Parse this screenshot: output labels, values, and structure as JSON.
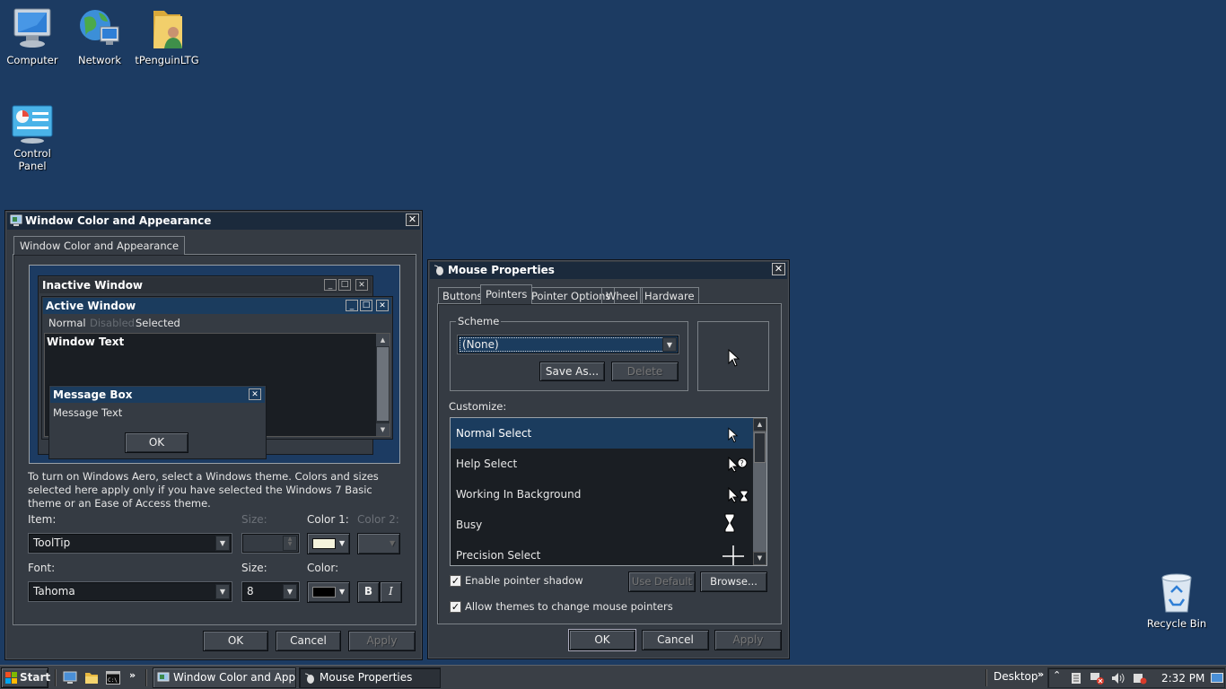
{
  "desktop": {
    "icons": [
      {
        "label": "Computer",
        "icon": "computer-icon"
      },
      {
        "label": "Network",
        "icon": "network-icon"
      },
      {
        "label": "tPenguinLTG",
        "icon": "user-folder-icon"
      },
      {
        "label": "Control Panel",
        "icon": "control-panel-icon"
      },
      {
        "label": "Recycle Bin",
        "icon": "recycle-bin-icon"
      }
    ]
  },
  "appearance": {
    "title": "Window Color and Appearance",
    "tab": "Window Color and Appearance",
    "preview": {
      "inactive": "Inactive Window",
      "active": "Active Window",
      "menu_normal": "Normal",
      "menu_disabled": "Disabled",
      "menu_selected": "Selected",
      "window_text": "Window Text",
      "msgbox_title": "Message Box",
      "msgbox_text": "Message Text",
      "msgbox_ok": "OK"
    },
    "info": "To turn on Windows Aero, select a Windows theme.  Colors and sizes selected here apply only if you have selected the Windows 7 Basic theme or an Ease of Access theme.",
    "item_label": "Item:",
    "item_value": "ToolTip",
    "size_label": "Size:",
    "color1_label": "Color 1:",
    "color2_label": "Color 2:",
    "font_label": "Font:",
    "font_value": "Tahoma",
    "font_size_label": "Size:",
    "font_size_value": "8",
    "font_color_label": "Color:",
    "bold": "B",
    "italic": "I",
    "ok": "OK",
    "cancel": "Cancel",
    "apply": "Apply",
    "color1_swatch": "#f5f3dc",
    "font_color_swatch": "#000000"
  },
  "mouse": {
    "title": "Mouse Properties",
    "tabs": [
      "Buttons",
      "Pointers",
      "Pointer Options",
      "Wheel",
      "Hardware"
    ],
    "active_tab": "Pointers",
    "scheme_label": "Scheme",
    "scheme_value": "(None)",
    "save_as": "Save As...",
    "delete": "Delete",
    "customize_label": "Customize:",
    "pointers": [
      {
        "label": "Normal Select",
        "icon": "arrow-cursor-icon"
      },
      {
        "label": "Help Select",
        "icon": "help-cursor-icon"
      },
      {
        "label": "Working In Background",
        "icon": "working-cursor-icon"
      },
      {
        "label": "Busy",
        "icon": "hourglass-cursor-icon"
      },
      {
        "label": "Precision Select",
        "icon": "crosshair-cursor-icon"
      }
    ],
    "enable_shadow": "Enable pointer shadow",
    "use_default": "Use Default",
    "browse": "Browse...",
    "allow_themes": "Allow themes to change mouse pointers",
    "ok": "OK",
    "cancel": "Cancel",
    "apply": "Apply"
  },
  "taskbar": {
    "start": "Start",
    "tasks": [
      "Window Color and Appe...",
      "Mouse Properties"
    ],
    "desktop_label": "Desktop",
    "time": "2:32 PM"
  }
}
